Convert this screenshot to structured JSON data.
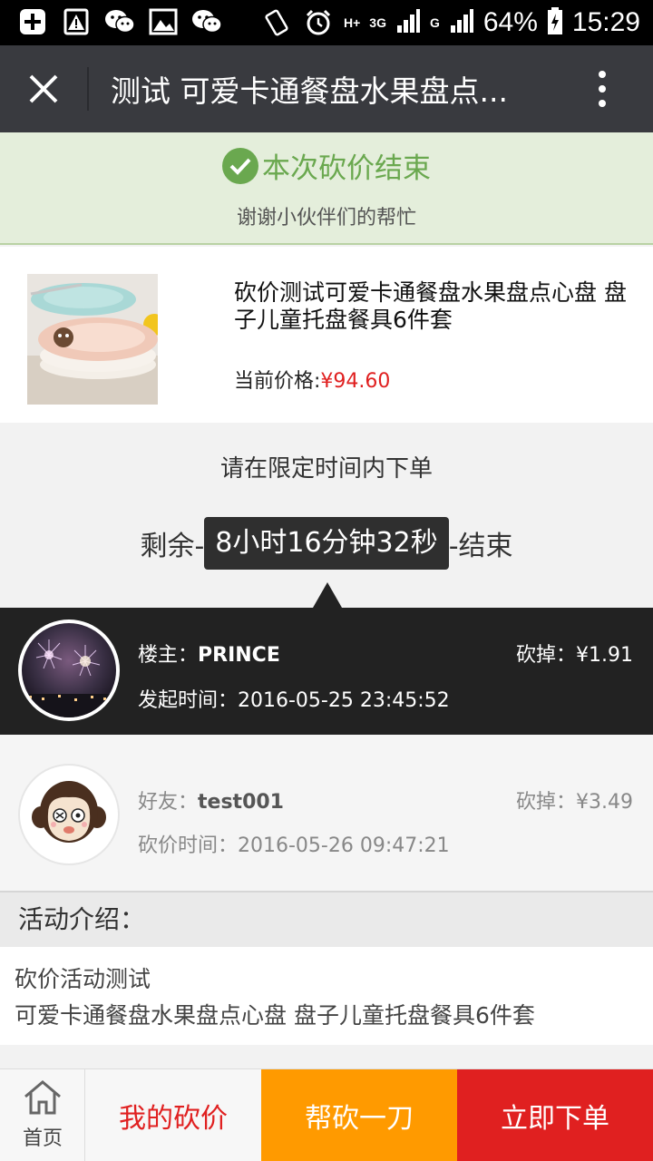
{
  "status_bar": {
    "signal_h": "H+",
    "signal_3g": "3G",
    "signal_g": "G",
    "battery": "64%",
    "time": "15:29",
    "icons": [
      "add-icon",
      "warning-icon",
      "wechat-icon",
      "image-icon",
      "wechat-icon",
      "rotate-icon",
      "alarm-icon",
      "signal-icon",
      "signal-icon",
      "battery-icon"
    ]
  },
  "title_bar": {
    "title": "测试 可爱卡通餐盘水果盘点...",
    "icons": [
      "close-icon",
      "more-icon"
    ]
  },
  "banner": {
    "title": "本次砍价结束",
    "subtitle": "谢谢小伙伴们的帮忙",
    "color": "#6aa84f"
  },
  "product": {
    "name": "砍价测试可爱卡通餐盘水果盘点心盘 盘子儿童托盘餐具6件套",
    "price_label": "当前价格:",
    "price_value": "¥94.60"
  },
  "countdown": {
    "prompt": "请在限定时间内下单",
    "prefix": "剩余-",
    "time": "8小时16分钟32秒",
    "suffix": "-结束"
  },
  "owner": {
    "role_label": "楼主：",
    "name": "PRINCE",
    "cut": "砍掉：¥1.91",
    "time": "发起时间：2016-05-25 23:45:52"
  },
  "friend": {
    "role_label": "好友：",
    "name": "test001",
    "cut": "砍掉：¥3.49",
    "time": "砍价时间：2016-05-26 09:47:21"
  },
  "intro": {
    "title": "活动介绍：",
    "line1": "砍价活动测试",
    "line2": "可爱卡通餐盘水果盘点心盘 盘子儿童托盘餐具6件套"
  },
  "bottom_bar": {
    "home": "首页",
    "my_bargain": "我的砍价",
    "help_cut": "帮砍一刀",
    "order_now": "立即下单",
    "colors": {
      "help": "#ff9a00",
      "order": "#e02020"
    }
  }
}
